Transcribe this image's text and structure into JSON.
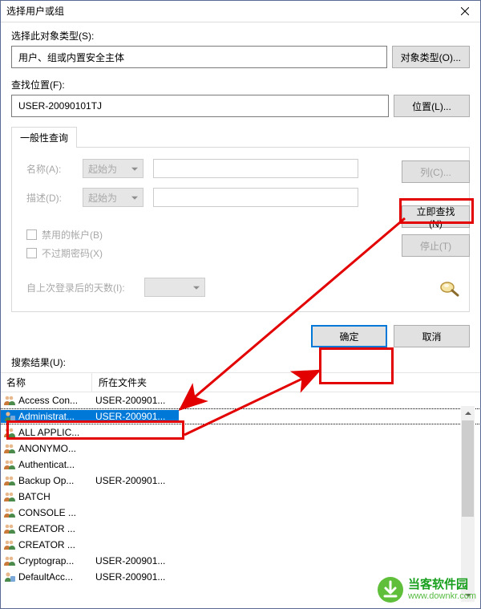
{
  "titlebar": {
    "title": "选择用户或组"
  },
  "objectType": {
    "label": "选择此对象类型(S):",
    "value": "用户、组或内置安全主体",
    "button": "对象类型(O)..."
  },
  "location": {
    "label": "查找位置(F):",
    "value": "USER-20090101TJ",
    "button": "位置(L)..."
  },
  "tabs": {
    "generalQuery": "一般性查询"
  },
  "query": {
    "name_label": "名称(A):",
    "desc_label": "描述(D):",
    "name_mode": "起始为",
    "desc_mode": "起始为",
    "chk_disabled": "禁用的帐户(B)",
    "chk_nonexpire": "不过期密码(X)",
    "days_label": "自上次登录后的天数(I):"
  },
  "sideButtons": {
    "columns": "列(C)...",
    "findNow": "立即查找(N)",
    "stop": "停止(T)"
  },
  "resultButtons": {
    "ok": "确定",
    "cancel": "取消"
  },
  "results": {
    "label": "搜索结果(U):",
    "col_name": "名称",
    "col_folder": "所在文件夹",
    "rows": [
      {
        "icon": "group",
        "name": "Access Con...",
        "folder": "USER-200901..."
      },
      {
        "icon": "user",
        "name": "Administrat...",
        "folder": "USER-200901...",
        "selected": true
      },
      {
        "icon": "group",
        "name": "ALL APPLIC...",
        "folder": ""
      },
      {
        "icon": "group",
        "name": "ANONYMO...",
        "folder": ""
      },
      {
        "icon": "group",
        "name": "Authenticat...",
        "folder": ""
      },
      {
        "icon": "group",
        "name": "Backup Op...",
        "folder": "USER-200901..."
      },
      {
        "icon": "group",
        "name": "BATCH",
        "folder": ""
      },
      {
        "icon": "group",
        "name": "CONSOLE ...",
        "folder": ""
      },
      {
        "icon": "group",
        "name": "CREATOR ...",
        "folder": ""
      },
      {
        "icon": "group",
        "name": "CREATOR ...",
        "folder": ""
      },
      {
        "icon": "group",
        "name": "Cryptograp...",
        "folder": "USER-200901..."
      },
      {
        "icon": "user",
        "name": "DefaultAcc...",
        "folder": "USER-200901..."
      }
    ]
  },
  "watermark": {
    "main": "当客软件园",
    "sub": "www.downkr.com"
  }
}
